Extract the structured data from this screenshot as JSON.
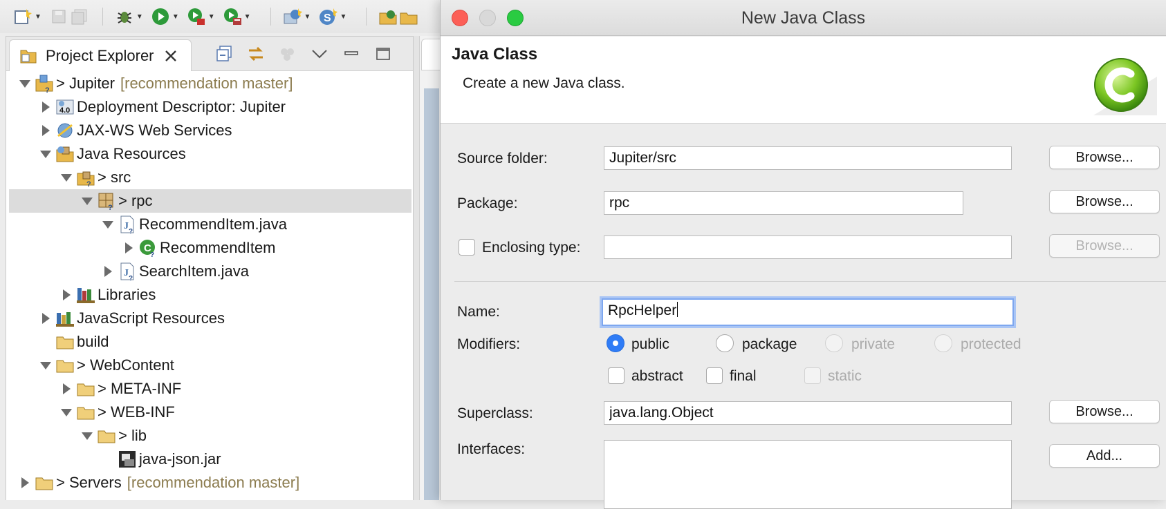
{
  "explorer": {
    "tab_label": "Project Explorer",
    "tree": [
      {
        "label": "> Jupiter",
        "branch": "[recommendation master]",
        "expanded": true,
        "icon": "project-icon"
      },
      {
        "label": "Deployment Descriptor: Jupiter",
        "expanded": false,
        "icon": "deployment-descriptor-icon"
      },
      {
        "label": "JAX-WS Web Services",
        "expanded": false,
        "icon": "web-services-icon"
      },
      {
        "label": "Java Resources",
        "expanded": true,
        "icon": "java-resources-icon"
      },
      {
        "label": "> src",
        "expanded": true,
        "icon": "source-folder-icon"
      },
      {
        "label": "> rpc",
        "expanded": true,
        "icon": "package-icon",
        "selected": true
      },
      {
        "label": "RecommendItem.java",
        "expanded": true,
        "icon": "java-file-icon"
      },
      {
        "label": "RecommendItem",
        "expanded": false,
        "icon": "class-icon"
      },
      {
        "label": "SearchItem.java",
        "expanded": false,
        "icon": "java-file-icon"
      },
      {
        "label": "Libraries",
        "expanded": false,
        "icon": "libraries-icon"
      },
      {
        "label": "JavaScript Resources",
        "expanded": false,
        "icon": "javascript-resources-icon"
      },
      {
        "label": "build",
        "icon": "folder-icon"
      },
      {
        "label": "> WebContent",
        "expanded": true,
        "icon": "folder-icon"
      },
      {
        "label": "> META-INF",
        "expanded": false,
        "icon": "folder-icon"
      },
      {
        "label": "> WEB-INF",
        "expanded": true,
        "icon": "folder-icon"
      },
      {
        "label": "> lib",
        "expanded": true,
        "icon": "folder-icon"
      },
      {
        "label": "java-json.jar",
        "icon": "jar-icon"
      },
      {
        "label": "> Servers",
        "branch": "[recommendation master]",
        "expanded": false,
        "icon": "folder-icon"
      }
    ]
  },
  "dialog": {
    "title": "New Java Class",
    "banner_title": "Java Class",
    "banner_description": "Create a new Java class.",
    "source_folder": {
      "label": "Source folder:",
      "value": "Jupiter/src",
      "button": "Browse..."
    },
    "package": {
      "label": "Package:",
      "value": "rpc",
      "button": "Browse..."
    },
    "enclosing_type": {
      "label": "Enclosing type:",
      "value": "",
      "button": "Browse..."
    },
    "name": {
      "label": "Name:",
      "value": "RpcHelper"
    },
    "modifiers": {
      "label": "Modifiers:",
      "access": [
        {
          "label": "public",
          "checked": true,
          "enabled": true
        },
        {
          "label": "package",
          "checked": false,
          "enabled": true
        },
        {
          "label": "private",
          "checked": false,
          "enabled": false
        },
        {
          "label": "protected",
          "checked": false,
          "enabled": false
        }
      ],
      "other": [
        {
          "label": "abstract",
          "checked": false,
          "enabled": true
        },
        {
          "label": "final",
          "checked": false,
          "enabled": true
        },
        {
          "label": "static",
          "checked": false,
          "enabled": false
        }
      ]
    },
    "superclass": {
      "label": "Superclass:",
      "value": "java.lang.Object",
      "button": "Browse..."
    },
    "interfaces": {
      "label": "Interfaces:",
      "button": "Add..."
    }
  },
  "colors": {
    "accent": "#2f7cf6",
    "branch_text": "#8b7b4e",
    "selection": "#dcdcdc",
    "focus_ring": "#a9c5f5"
  }
}
